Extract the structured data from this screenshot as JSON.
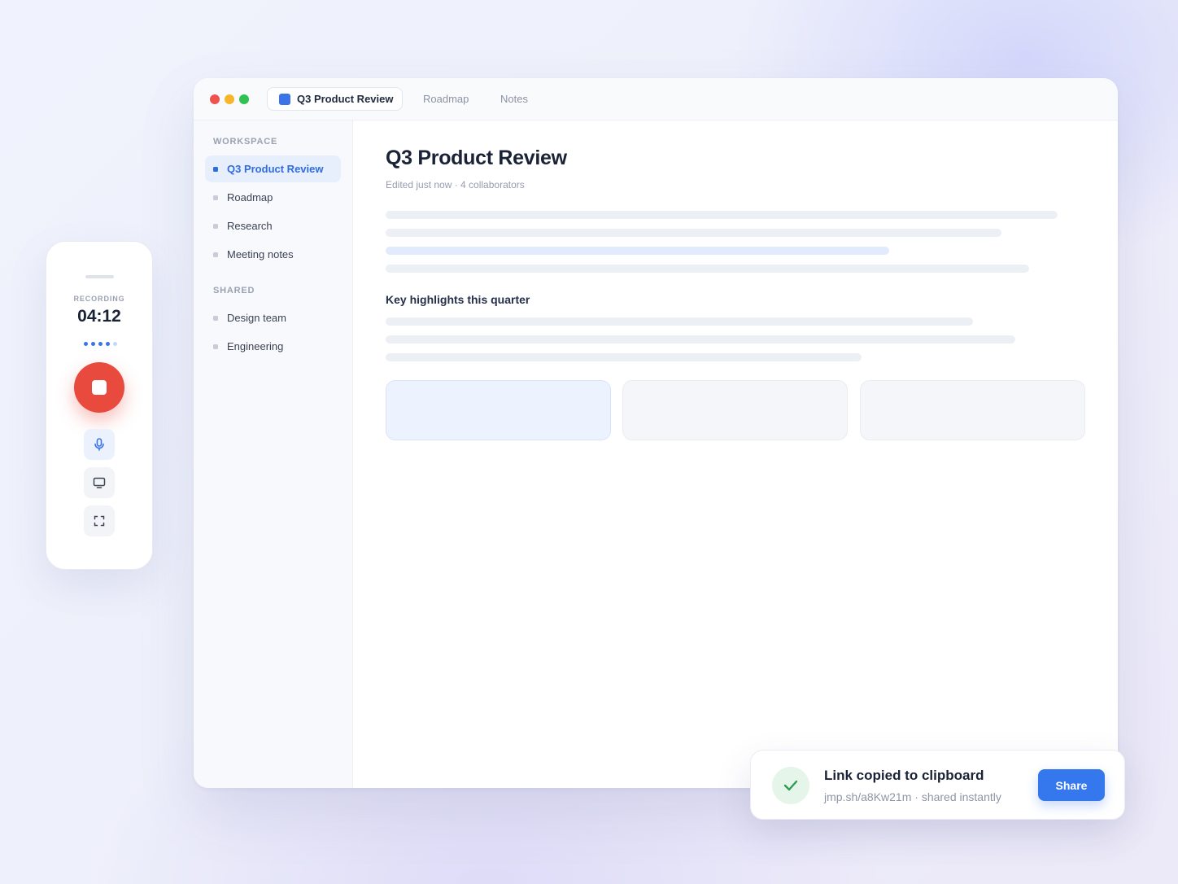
{
  "window": {
    "tabs": [
      {
        "label": "Q3 Product Review",
        "active": true
      },
      {
        "label": "Roadmap",
        "active": false
      },
      {
        "label": "Notes",
        "active": false
      }
    ]
  },
  "sidebar": {
    "sections": [
      {
        "label": "WORKSPACE",
        "items": [
          {
            "label": "Q3 Product Review",
            "active": true
          },
          {
            "label": "Roadmap"
          },
          {
            "label": "Research"
          },
          {
            "label": "Meeting notes"
          }
        ]
      },
      {
        "label": "SHARED",
        "items": [
          {
            "label": "Design team"
          },
          {
            "label": "Engineering"
          }
        ]
      }
    ]
  },
  "document": {
    "title": "Q3 Product Review",
    "meta": "Edited just now · 4 collaborators",
    "subheading": "Key highlights this quarter"
  },
  "recorder": {
    "label": "RECORDING",
    "time": "04:12",
    "stop_color": "#e84a3e",
    "tools": [
      "microphone-icon",
      "screen-icon",
      "fullscreen-icon"
    ]
  },
  "toast": {
    "title": "Link copied to clipboard",
    "subtitle": "jmp.sh/a8Kw21m · shared instantly",
    "button_label": "Share",
    "icon": "check-icon",
    "accent": "#3577ec"
  }
}
